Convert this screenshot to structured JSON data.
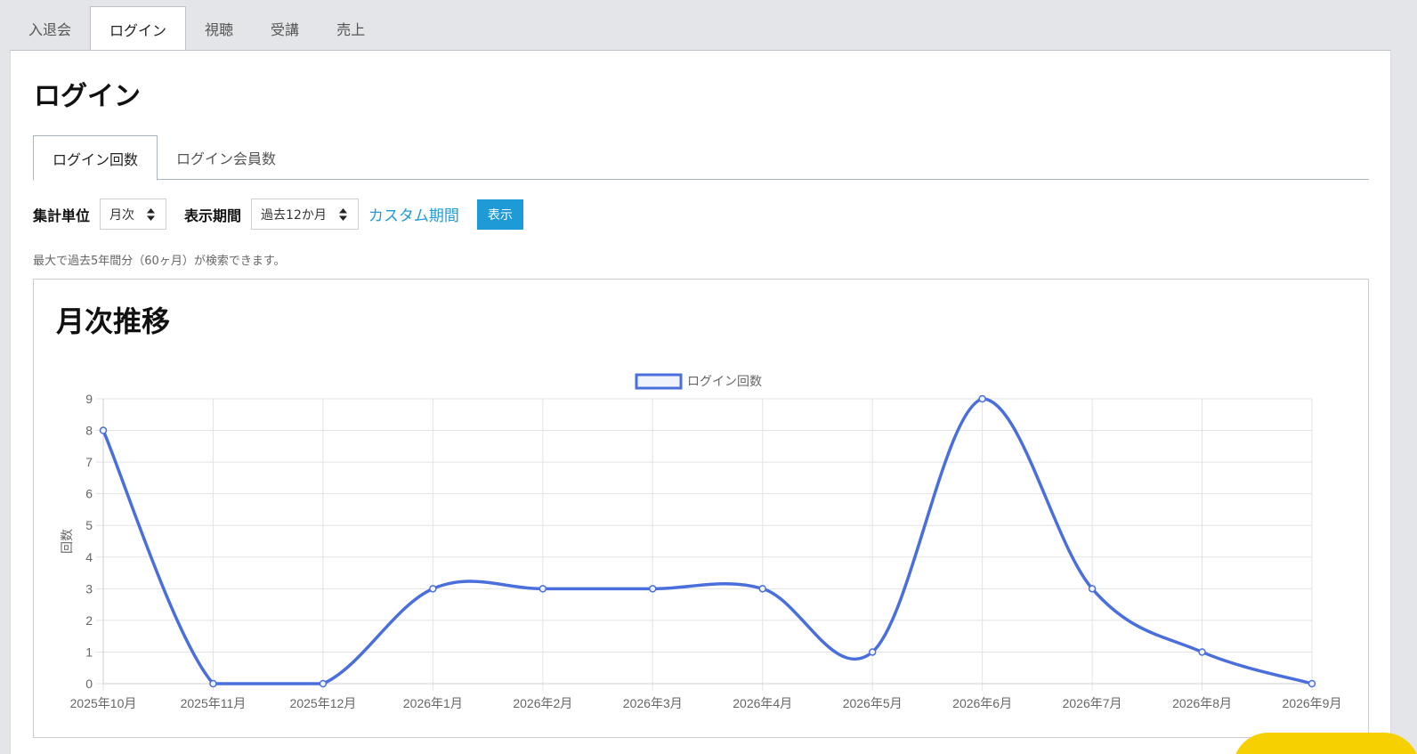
{
  "top_tabs": [
    {
      "label": "入退会",
      "active": false
    },
    {
      "label": "ログイン",
      "active": true
    },
    {
      "label": "視聴",
      "active": false
    },
    {
      "label": "受講",
      "active": false
    },
    {
      "label": "売上",
      "active": false
    }
  ],
  "page_title": "ログイン",
  "sub_tabs": [
    {
      "label": "ログイン回数",
      "active": true
    },
    {
      "label": "ログイン会員数",
      "active": false
    }
  ],
  "controls": {
    "unit_label": "集計単位",
    "unit_value": "月次",
    "period_label": "表示期間",
    "period_value": "過去12か月",
    "custom_link": "カスタム期間",
    "show_button": "表示"
  },
  "note": "最大で過去5年間分（60ヶ月）が検索できます。",
  "chart_card_title": "月次推移",
  "colors": {
    "accent": "#1e9ad6",
    "series": "#4a6fdc",
    "legend_fill": "#f0f3fc"
  },
  "chart_data": {
    "type": "line",
    "title": "",
    "xlabel": "",
    "ylabel": "回数",
    "ylim": [
      0,
      9
    ],
    "yticks": [
      "0",
      "1",
      "2",
      "3",
      "4",
      "5",
      "6",
      "7",
      "8",
      "9"
    ],
    "categories": [
      "2025年10月",
      "2025年11月",
      "2025年12月",
      "2026年1月",
      "2026年2月",
      "2026年3月",
      "2026年4月",
      "2026年5月",
      "2026年6月",
      "2026年7月",
      "2026年8月",
      "2026年9月"
    ],
    "series": [
      {
        "name": "ログイン回数",
        "values": [
          8,
          0,
          0,
          3,
          3,
          3,
          3,
          1,
          9,
          3,
          1,
          0
        ]
      }
    ],
    "legend_position": "top-center",
    "grid": true,
    "smooth": true
  }
}
